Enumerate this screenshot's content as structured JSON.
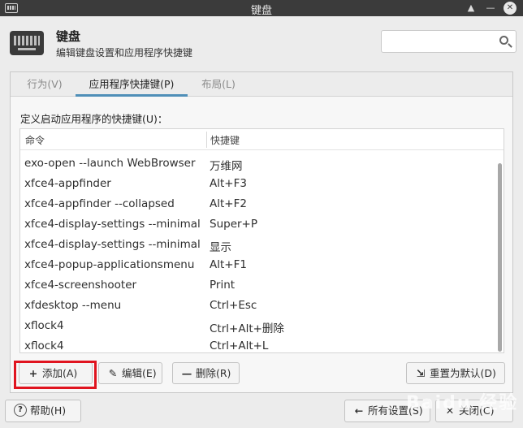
{
  "window": {
    "title": "键盘"
  },
  "header": {
    "title": "键盘",
    "subtitle": "编辑键盘设置和应用程序快捷键",
    "search_placeholder": ""
  },
  "tabs": [
    {
      "label": "行为(V)"
    },
    {
      "label": "应用程序快捷键(P)"
    },
    {
      "label": "布局(L)"
    }
  ],
  "shortcuts": {
    "list_label": "定义启动应用程序的快捷键(U)：",
    "col_command": "命令",
    "col_shortcut": "快捷键",
    "rows": [
      {
        "command": "exo-open --launch WebBrowser",
        "shortcut": "万维网"
      },
      {
        "command": "xfce4-appfinder",
        "shortcut": "Alt+F3"
      },
      {
        "command": "xfce4-appfinder --collapsed",
        "shortcut": "Alt+F2"
      },
      {
        "command": "xfce4-display-settings --minimal",
        "shortcut": "Super+P"
      },
      {
        "command": "xfce4-display-settings --minimal",
        "shortcut": "显示"
      },
      {
        "command": "xfce4-popup-applicationsmenu",
        "shortcut": "Alt+F1"
      },
      {
        "command": "xfce4-screenshooter",
        "shortcut": "Print"
      },
      {
        "command": "xfdesktop --menu",
        "shortcut": "Ctrl+Esc"
      },
      {
        "command": "xflock4",
        "shortcut": "Ctrl+Alt+删除"
      },
      {
        "command": "xflock4",
        "shortcut": "Ctrl+Alt+L"
      }
    ]
  },
  "buttons": {
    "add": "添加(A)",
    "edit": "编辑(E)",
    "delete": "删除(R)",
    "reset": "重置为默认(D)",
    "help": "帮助(H)",
    "all_settings": "所有设置(S)",
    "close": "关闭(C)"
  },
  "watermark": "Baidu 经验",
  "colors": {
    "titlebar": "#3b3b3b",
    "active_tab_underline": "#4f8fb8",
    "highlight_box": "#e0141f"
  },
  "icons": {
    "window": "keyboard-icon",
    "header": "keyboard-icon",
    "search": "search-icon",
    "add": "plus-icon",
    "edit": "pencil-icon",
    "delete": "minus-icon",
    "reset": "reset-icon",
    "help": "help-icon",
    "all_settings": "back-arrow-icon",
    "close": "close-icon"
  }
}
